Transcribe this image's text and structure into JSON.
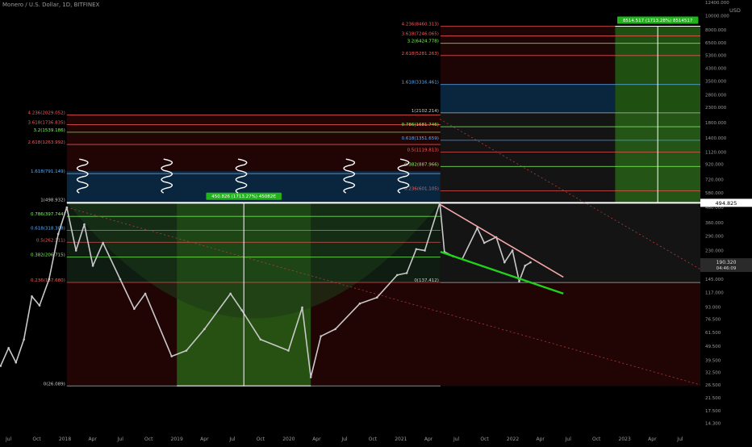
{
  "header": {
    "symbol_title": "Monero / U.S. Dollar, 1D, BITFINEX",
    "currency": "USD"
  },
  "colors": {
    "background": "#000000",
    "candle": "#c8c8c8",
    "green_zone": "#2a6b17",
    "blue_zone": "#0b2f4d",
    "red_zone": "#3c0a0a",
    "support_line": "#22d11c",
    "resistance_line": "#f4a6a6",
    "fib_red": "#ff5a5a",
    "fib_green": "#7fff5a",
    "fib_blue": "#5ab0ff",
    "label_green_bg": "#22b21c"
  },
  "chart_data": {
    "type": "line",
    "title": "Monero / U.S. Dollar, 1D, BITFINEX",
    "scale": "log",
    "ylim": [
      12.5,
      12400
    ],
    "xlim": [
      "2017-06-03",
      "2023-09-05"
    ],
    "x_tick_labels": [
      "Jul",
      "Oct",
      "2018",
      "Apr",
      "Jul",
      "Oct",
      "2019",
      "Apr",
      "Jul",
      "Oct",
      "2020",
      "Apr",
      "Jul",
      "Oct",
      "2021",
      "Apr",
      "Jul",
      "Oct",
      "2022",
      "Apr",
      "Jul",
      "Oct",
      "2023",
      "Apr",
      "Jul"
    ],
    "y_tick_labels": [
      "12400.000",
      "10000.000",
      "8000.000",
      "6500.000",
      "5300.000",
      "4300.000",
      "3500.000",
      "2800.000",
      "2300.000",
      "1800.000",
      "1400.000",
      "1120.000",
      "920.000",
      "720.000",
      "580.000",
      "460.000",
      "360.000",
      "290.000",
      "230.000",
      "145.000",
      "117.000",
      "93.000",
      "76.500",
      "61.500",
      "49.500",
      "39.500",
      "32.500",
      "26.500",
      "21.500",
      "17.500",
      "14.300"
    ],
    "current_price_label": "494.825",
    "last_price_label": "190.320",
    "countdown_label": "04:46:09",
    "series": [
      {
        "values": [
          {
            "x": "2017-06-05",
            "y": 36
          },
          {
            "x": "2017-07-01",
            "y": 48
          },
          {
            "x": "2017-07-25",
            "y": 38
          },
          {
            "x": "2017-08-20",
            "y": 55
          },
          {
            "x": "2017-09-15",
            "y": 110
          },
          {
            "x": "2017-10-10",
            "y": 95
          },
          {
            "x": "2017-11-10",
            "y": 145
          },
          {
            "x": "2017-12-10",
            "y": 300
          },
          {
            "x": "2018-01-07",
            "y": 460
          },
          {
            "x": "2018-02-06",
            "y": 230
          },
          {
            "x": "2018-03-05",
            "y": 350
          },
          {
            "x": "2018-04-02",
            "y": 180
          },
          {
            "x": "2018-05-05",
            "y": 260
          },
          {
            "x": "2018-06-30",
            "y": 145
          },
          {
            "x": "2018-08-15",
            "y": 90
          },
          {
            "x": "2018-09-20",
            "y": 115
          },
          {
            "x": "2018-12-15",
            "y": 42
          },
          {
            "x": "2019-02-01",
            "y": 46
          },
          {
            "x": "2019-04-01",
            "y": 65
          },
          {
            "x": "2019-06-25",
            "y": 115
          },
          {
            "x": "2019-08-01",
            "y": 88
          },
          {
            "x": "2019-10-01",
            "y": 55
          },
          {
            "x": "2019-12-31",
            "y": 46
          },
          {
            "x": "2020-02-14",
            "y": 92
          },
          {
            "x": "2020-03-13",
            "y": 30
          },
          {
            "x": "2020-04-15",
            "y": 58
          },
          {
            "x": "2020-06-01",
            "y": 65
          },
          {
            "x": "2020-08-20",
            "y": 98
          },
          {
            "x": "2020-10-15",
            "y": 108
          },
          {
            "x": "2020-12-20",
            "y": 155
          },
          {
            "x": "2021-01-20",
            "y": 160
          },
          {
            "x": "2021-02-20",
            "y": 235
          },
          {
            "x": "2021-03-20",
            "y": 230
          },
          {
            "x": "2021-05-08",
            "y": 495
          },
          {
            "x": "2021-05-23",
            "y": 225
          },
          {
            "x": "2021-06-20",
            "y": 210
          },
          {
            "x": "2021-07-20",
            "y": 200
          },
          {
            "x": "2021-09-07",
            "y": 330
          },
          {
            "x": "2021-09-30",
            "y": 260
          },
          {
            "x": "2021-11-08",
            "y": 285
          },
          {
            "x": "2021-12-05",
            "y": 190
          },
          {
            "x": "2021-12-31",
            "y": 230
          },
          {
            "x": "2022-01-22",
            "y": 140
          },
          {
            "x": "2022-02-10",
            "y": 180
          },
          {
            "x": "2022-02-28",
            "y": 190
          }
        ]
      }
    ],
    "fib_left": [
      "4.236(2029.052)",
      "3.618(1736.835)",
      "3.2(1539.186)",
      "2.618(1263.992)",
      "1.618(791.149)",
      "1(498.932)",
      "0.786(397.744)",
      "0.618(318.308)",
      "0.5(262.511)",
      "0.382(206.715)",
      "0.236(137.680)",
      "0(26.089)"
    ],
    "fib_mid": [
      "1(2102.214)",
      "0.786(1681.746)",
      "0.618(1351.659)",
      "0.5(1119.813)",
      "0.382(887.966)",
      "0.236(601.105)",
      "0(137.412)"
    ],
    "fib_right": [
      "4.236(8460.313)",
      "3.618(7246.065)",
      "3.2(6424.778)",
      "2.618(5281.263)",
      "1.618(3316.461)"
    ],
    "measure_labels": [
      "450.826 (1713.27%) 45082Є",
      "8514.517 (1713.28%) 8514517"
    ]
  }
}
